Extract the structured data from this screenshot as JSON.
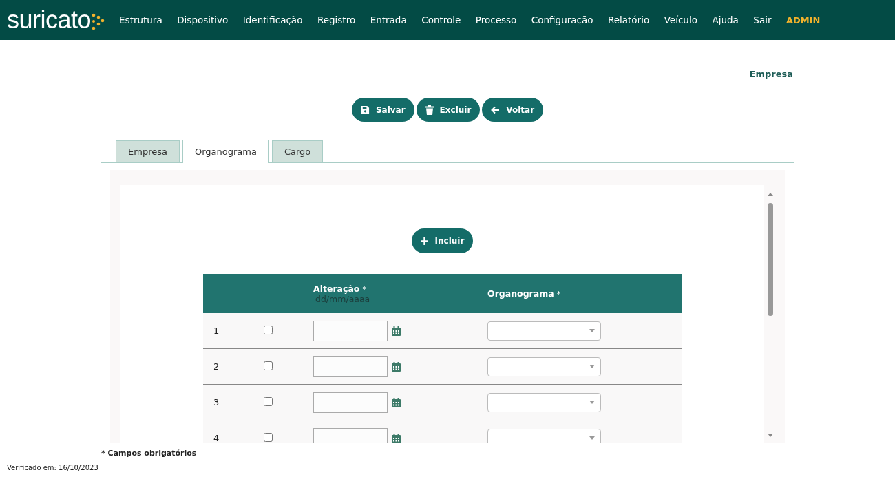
{
  "brand": "suricato",
  "nav": [
    {
      "label": "Estrutura",
      "kind": "link"
    },
    {
      "label": "Dispositivo",
      "kind": "link"
    },
    {
      "label": "Identificação",
      "kind": "link"
    },
    {
      "label": "Registro",
      "kind": "link"
    },
    {
      "label": "Entrada",
      "kind": "link"
    },
    {
      "label": "Controle",
      "kind": "link"
    },
    {
      "label": "Processo",
      "kind": "link"
    },
    {
      "label": "Configuração",
      "kind": "link"
    },
    {
      "label": "Relatório",
      "kind": "link"
    },
    {
      "label": "Veículo",
      "kind": "link"
    },
    {
      "label": "Ajuda",
      "kind": "link"
    },
    {
      "label": "Sair",
      "kind": "link"
    },
    {
      "label": "ADMIN",
      "kind": "user"
    }
  ],
  "page_title": "Empresa",
  "actions": [
    {
      "label": "Salvar",
      "kind": "save"
    },
    {
      "label": "Excluir",
      "kind": "delete"
    },
    {
      "label": "Voltar",
      "kind": "back"
    }
  ],
  "tabs": [
    {
      "label": "Empresa",
      "selected": false
    },
    {
      "label": "Organograma",
      "selected": true
    },
    {
      "label": "Cargo",
      "selected": false
    }
  ],
  "add_button": "Incluir",
  "table": {
    "columns": [
      {
        "label": "Alteração",
        "mark": "*",
        "hint": "dd/mm/aaaa"
      },
      {
        "label": "Organograma",
        "mark": "*"
      }
    ],
    "rows": [
      {
        "number": "1",
        "checked": false
      },
      {
        "number": "2",
        "checked": false
      },
      {
        "number": "3",
        "checked": false
      },
      {
        "number": "4",
        "checked": false
      }
    ]
  },
  "required_note": "* Campos obrigatórios",
  "verified": "Verificado em: 16/10/2023"
}
